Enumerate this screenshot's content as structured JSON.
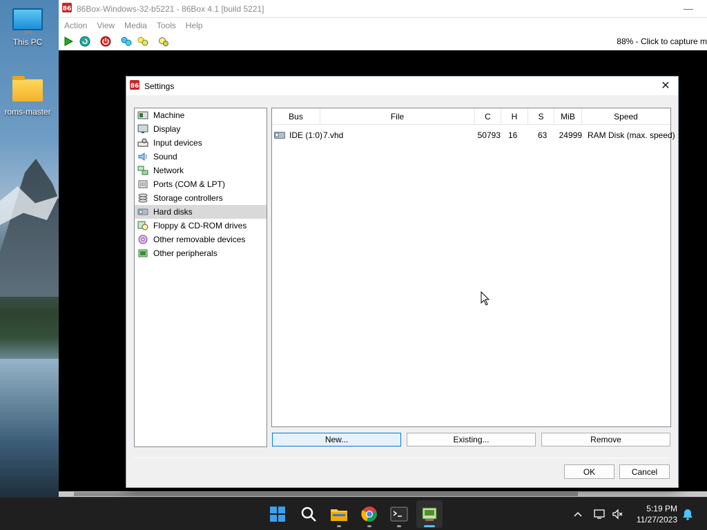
{
  "desktop": {
    "icons": [
      {
        "label": "This PC",
        "icon": "computer-icon"
      },
      {
        "label": "roms-master",
        "icon": "folder-icon"
      }
    ]
  },
  "main_window": {
    "title": "86Box-Windows-32-b5221 - 86Box 4.1 [build 5221]",
    "menu": [
      "Action",
      "View",
      "Media",
      "Tools",
      "Help"
    ],
    "toolbar_icons": [
      "play-icon",
      "reset-icon",
      "power-icon",
      "ctrl-alt-del-icon",
      "ctrl-alt-esc-icon",
      "settings-icon"
    ],
    "status_text": "88% - Click to capture m"
  },
  "settings_dialog": {
    "title": "Settings",
    "nav_items": [
      {
        "label": "Machine",
        "icon": "machine-icon",
        "color": "#2e7d32"
      },
      {
        "label": "Display",
        "icon": "display-icon",
        "color": "#455a64"
      },
      {
        "label": "Input devices",
        "icon": "input-devices-icon",
        "color": "#333333"
      },
      {
        "label": "Sound",
        "icon": "sound-icon",
        "color": "#3b6ea8"
      },
      {
        "label": "Network",
        "icon": "network-icon",
        "color": "#2e7d32"
      },
      {
        "label": "Ports (COM & LPT)",
        "icon": "ports-icon",
        "color": "#555555"
      },
      {
        "label": "Storage controllers",
        "icon": "storage-controllers-icon",
        "color": "#555555"
      },
      {
        "label": "Hard disks",
        "icon": "hard-disk-icon",
        "color": "#667788"
      },
      {
        "label": "Floppy & CD-ROM drives",
        "icon": "floppy-cdrom-icon",
        "color": "#2e7d32"
      },
      {
        "label": "Other removable devices",
        "icon": "removable-devices-icon",
        "color": "#7b3fa0"
      },
      {
        "label": "Other peripherals",
        "icon": "peripherals-icon",
        "color": "#2e7d32"
      }
    ],
    "selected_nav": "Hard disks",
    "table": {
      "headers": [
        "Bus",
        "File",
        "C",
        "H",
        "S",
        "MiB",
        "Speed"
      ],
      "rows": [
        {
          "bus": "IDE (1:0)",
          "file": "7.vhd",
          "c": "50793",
          "h": "16",
          "s": "63",
          "mib": "24999",
          "speed": "RAM Disk (max. speed)"
        }
      ]
    },
    "buttons": {
      "new": "New...",
      "existing": "Existing...",
      "remove": "Remove",
      "ok": "OK",
      "cancel": "Cancel"
    }
  },
  "taskbar": {
    "apps": [
      "start-icon",
      "search-icon",
      "file-explorer-icon",
      "chrome-icon",
      "terminal-icon",
      "86box-icon"
    ],
    "time": "5:19 PM",
    "date": "11/27/2023"
  }
}
